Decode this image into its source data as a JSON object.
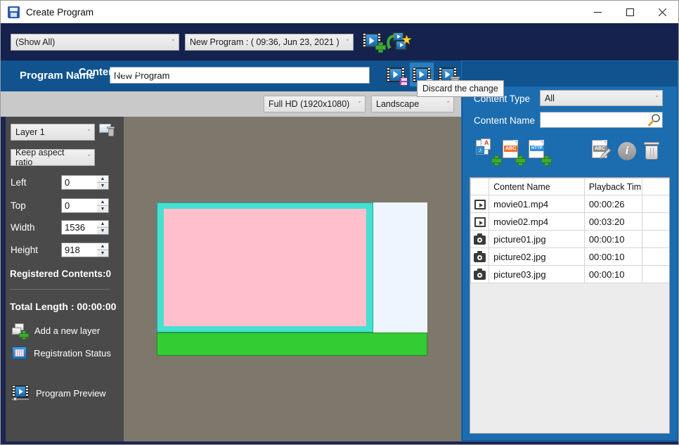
{
  "window": {
    "title": "Create Program",
    "icon": "app-icon",
    "minimize": "—",
    "maximize": "☐",
    "close": "✕"
  },
  "navbar": {
    "filter_combo": {
      "value": "(Show All)",
      "caret": "ˇ"
    },
    "program_combo": {
      "value": "New Program  : ( 09:36, Jun 23, 2021 )",
      "caret": "ˇ"
    },
    "icons": [
      {
        "name": "add-program-icon"
      },
      {
        "name": "copy-program-icon"
      }
    ]
  },
  "program_header": {
    "label": "Program Name",
    "input_value": "New Program",
    "buttons": [
      {
        "name": "save-program-button",
        "hover": false
      },
      {
        "name": "discard-change-button",
        "hover": true
      },
      {
        "name": "delete-program-button",
        "hover": false
      }
    ]
  },
  "tooltip": {
    "text": "Discard the change"
  },
  "settings_bar": {
    "resolution": {
      "value": "Full HD (1920x1080)",
      "caret": "ˇ"
    },
    "orientation": {
      "value": "Landscape",
      "caret": "ˇ"
    }
  },
  "left_panel": {
    "layer_combo": {
      "value": "Layer 1",
      "caret": "ˇ"
    },
    "aspect_combo": {
      "value": "Keep aspect ratio",
      "caret": "ˇ"
    },
    "delete_layer_icon": "delete-layer-icon",
    "fields": [
      {
        "label": "Left",
        "value": "0"
      },
      {
        "label": "Top",
        "value": "0"
      },
      {
        "label": "Width",
        "value": "1536"
      },
      {
        "label": "Height",
        "value": "918"
      }
    ],
    "spin_up": "▲",
    "spin_down": "▼",
    "registered_contents": "Registered Contents:0",
    "total_length": "Total Length : 00:00:00",
    "actions": [
      {
        "label": "Add a new layer",
        "icon": "add-layer-icon"
      },
      {
        "label": "Registration Status",
        "icon": "registration-status-icon"
      },
      {
        "label": "Program Preview",
        "icon": "program-preview-icon"
      }
    ]
  },
  "canvas": {
    "layers": [
      {
        "name": "layer-cyan-frame",
        "color": "#45e0d0"
      },
      {
        "name": "layer-pink-fill",
        "color": "#ffc0cb"
      },
      {
        "name": "layer-aliceblue",
        "color": "#eef5fe"
      },
      {
        "name": "layer-green-bar",
        "color": "#33cc33"
      }
    ],
    "background": "#7e776b"
  },
  "content_list": {
    "title": "Content List",
    "type_label": "Content Type",
    "type_value": "All",
    "type_caret": "ˇ",
    "name_label": "Content Name",
    "name_value": "",
    "name_placeholder": "",
    "search_icon": "search-icon",
    "toolbar": [
      {
        "name": "add-media-content-icon",
        "tag": ""
      },
      {
        "name": "add-text-content-icon",
        "tag": "ABC"
      },
      {
        "name": "add-http-content-icon",
        "tag": "HTTP"
      },
      {
        "name": "edit-content-icon",
        "tag": "ABC"
      },
      {
        "name": "content-info-icon",
        "tag": "i"
      },
      {
        "name": "delete-content-icon",
        "tag": ""
      }
    ],
    "columns": [
      "",
      "Content Name",
      "Playback Tim",
      ""
    ],
    "rows": [
      {
        "icon": "movie",
        "name": "movie01.mp4",
        "time": "00:00:26"
      },
      {
        "icon": "movie",
        "name": "movie02.mp4",
        "time": "00:03:20"
      },
      {
        "icon": "photo",
        "name": "picture01.jpg",
        "time": "00:00:10"
      },
      {
        "icon": "photo",
        "name": "picture02.jpg",
        "time": "00:00:10"
      },
      {
        "icon": "photo",
        "name": "picture03.jpg",
        "time": "00:00:10"
      }
    ]
  },
  "colors": {
    "titlebar": "#ffffff",
    "navbar": "#15224e",
    "header_blue": "#10538f",
    "panel_gray": "#4a4a4a",
    "canvas_bg": "#7e776b",
    "right_panel": "#1c6cb0",
    "accent_green": "#3faa35"
  }
}
